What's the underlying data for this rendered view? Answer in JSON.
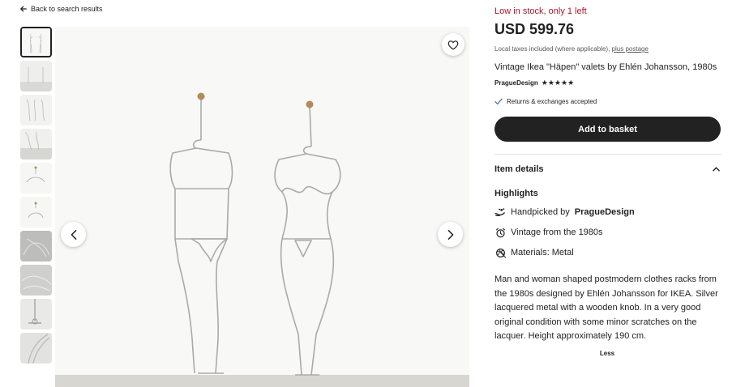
{
  "nav": {
    "back_label": "Back to search results"
  },
  "gallery": {
    "thumbnail_count": 10,
    "favorite_icon": "heart-icon",
    "prev_icon": "chevron-left-icon",
    "next_icon": "chevron-right-icon"
  },
  "listing": {
    "stock_text": "Low in stock, only 1 left",
    "price": "USD 599.76",
    "tax_text": "Local taxes included (where applicable),",
    "postage_link": "plus postage",
    "title": "Vintage Ikea \"Häpen\" valets by Ehlén Johansson, 1980s",
    "shop_name": "PragueDesign",
    "rating_stars": "★★★★★",
    "returns_text": "Returns & exchanges accepted",
    "add_button": "Add to basket"
  },
  "details": {
    "header": "Item details",
    "highlights_heading": "Highlights",
    "handpicked_prefix": "Handpicked by",
    "handpicked_shop": "PragueDesign",
    "vintage_text": "Vintage from the 1980s",
    "materials_text": "Materials: Metal",
    "description": "Man and woman shaped postmodern clothes racks from the 1980s designed by Ehlén Johansson for IKEA. Silver lacquered metal with a wooden knob. In a very good original condition with some minor scratches on the lacquer. Height approximately 190 cm.",
    "less_label": "Less"
  },
  "colors": {
    "stock_red": "#a61a2e",
    "button_dark": "#222222",
    "text_gray": "#595959"
  }
}
